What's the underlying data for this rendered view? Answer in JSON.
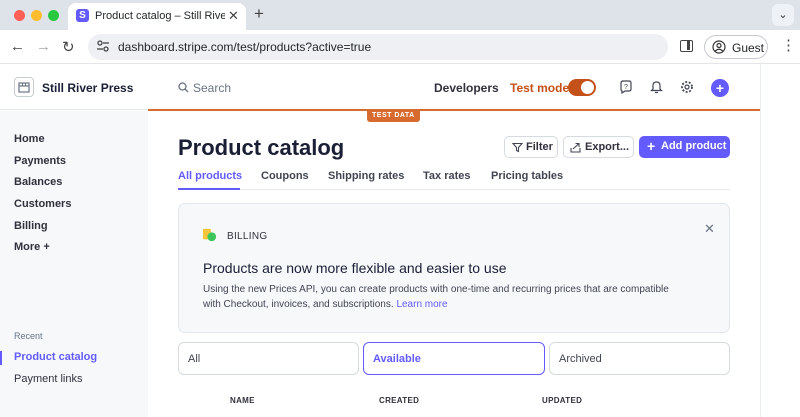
{
  "browser": {
    "tab_title": "Product catalog – Still River P",
    "tab_favicon": "S",
    "new_tab": "+",
    "url": "dashboard.stripe.com/test/products?active=true",
    "profile_label": "Guest",
    "traffic_lights": [
      "#ff5f57",
      "#febc2e",
      "#28c840"
    ]
  },
  "header": {
    "account_name": "Still River Press",
    "search_placeholder": "Search",
    "developers_label": "Developers",
    "test_mode_label": "Test mode",
    "test_mode_on": true,
    "test_data_badge": "TEST DATA",
    "accent_color": "#635bff",
    "test_color": "#c4501a"
  },
  "sidebar": {
    "items": [
      {
        "label": "Home"
      },
      {
        "label": "Payments"
      },
      {
        "label": "Balances"
      },
      {
        "label": "Customers"
      },
      {
        "label": "Billing"
      },
      {
        "label": "More +"
      }
    ],
    "recent_heading": "Recent",
    "recent": [
      {
        "label": "Product catalog",
        "active": true
      },
      {
        "label": "Payment links",
        "active": false
      }
    ]
  },
  "main": {
    "title": "Product catalog",
    "buttons": {
      "filter": "Filter",
      "export": "Export...",
      "add_product": "Add product"
    },
    "tabs": [
      {
        "label": "All products",
        "active": true
      },
      {
        "label": "Coupons"
      },
      {
        "label": "Shipping rates"
      },
      {
        "label": "Tax rates"
      },
      {
        "label": "Pricing tables"
      }
    ],
    "banner": {
      "label": "BILLING",
      "title": "Products are now more flexible and easier to use",
      "body": "Using the new Prices API, you can create products with one-time and recurring prices that are compatible with Checkout, invoices, and subscriptions.",
      "link": "Learn more"
    },
    "filters": [
      {
        "label": "All",
        "selected": false
      },
      {
        "label": "Available",
        "selected": true
      },
      {
        "label": "Archived",
        "selected": false
      }
    ],
    "columns": [
      "NAME",
      "CREATED",
      "UPDATED"
    ]
  }
}
